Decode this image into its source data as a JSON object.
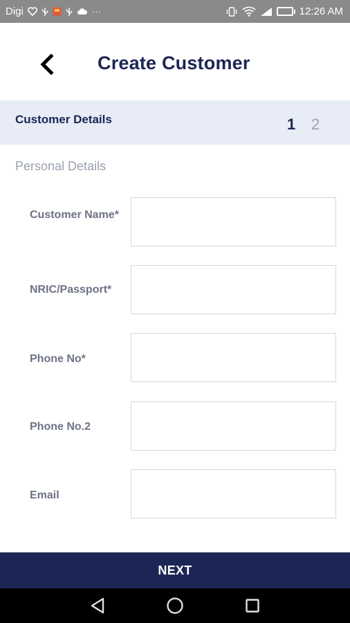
{
  "status_bar": {
    "carrier": "Digi",
    "time": "12:26 AM",
    "more_indicator": "···",
    "left_icons": [
      "heart-icon",
      "usb-icon",
      "notification-icon",
      "usb-icon",
      "cloud-icon"
    ],
    "right_icons": [
      "vibrate-icon",
      "wifi-icon",
      "signal-icon",
      "battery-icon"
    ],
    "battery_color": "#35c35a"
  },
  "header": {
    "title": "Create Customer",
    "back_icon": "chevron-left-icon"
  },
  "section": {
    "title": "Customer Details",
    "steps": [
      "1",
      "2"
    ],
    "active_step": "1"
  },
  "subsection": {
    "title": "Personal Details"
  },
  "form": {
    "fields": [
      {
        "label": "Customer Name*",
        "value": "",
        "placeholder": ""
      },
      {
        "label": "NRIC/Passport*",
        "value": "",
        "placeholder": ""
      },
      {
        "label": "Phone No*",
        "value": "",
        "placeholder": ""
      },
      {
        "label": "Phone No.2",
        "value": "",
        "placeholder": ""
      },
      {
        "label": "Email",
        "value": "",
        "placeholder": ""
      }
    ]
  },
  "footer": {
    "next_label": "NEXT"
  },
  "nav_bar": {
    "buttons": [
      "back-triangle-icon",
      "home-circle-icon",
      "recents-square-icon"
    ]
  },
  "colors": {
    "primary": "#1b2654",
    "section_band": "#e8ecf6",
    "muted_text": "#9aa0ae",
    "label_text": "#6d7285",
    "status_bar": "#8a8a8a"
  }
}
